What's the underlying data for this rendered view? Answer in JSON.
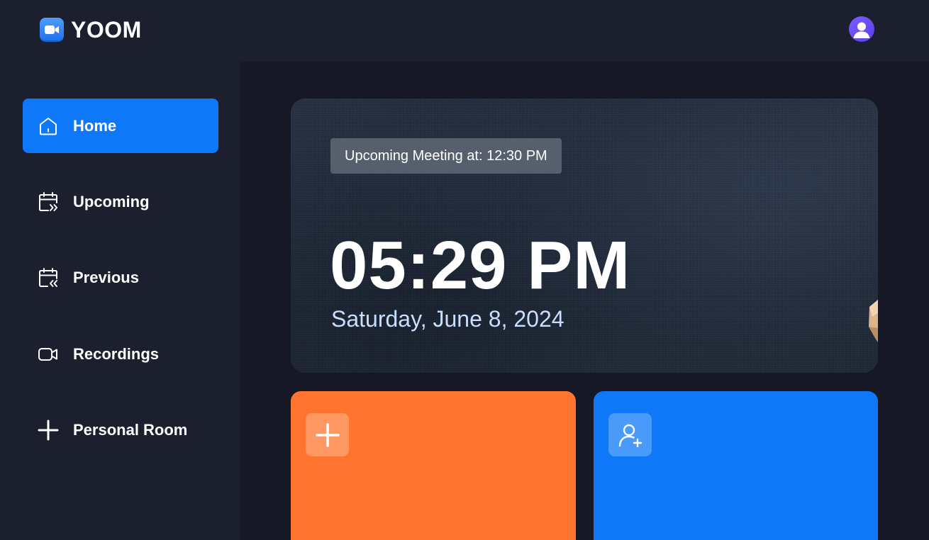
{
  "app": {
    "brand_name": "YOOM",
    "logo_icon": "video-camera-icon",
    "avatar_icon": "user-icon"
  },
  "sidebar": {
    "items": [
      {
        "label": "Home",
        "icon": "home-icon",
        "active": true
      },
      {
        "label": "Upcoming",
        "icon": "calendar-forward-icon",
        "active": false
      },
      {
        "label": "Previous",
        "icon": "calendar-back-icon",
        "active": false
      },
      {
        "label": "Recordings",
        "icon": "video-icon",
        "active": false
      },
      {
        "label": "Personal Room",
        "icon": "plus-icon",
        "active": false
      }
    ]
  },
  "hero": {
    "upcoming_text": "Upcoming Meeting at: 12:30 PM",
    "time": "05:29 PM",
    "date": "Saturday, June 8, 2024"
  },
  "cards": [
    {
      "icon": "plus-icon",
      "color": "#ff742e"
    },
    {
      "icon": "add-user-icon",
      "color": "#0e78f9"
    }
  ],
  "colors": {
    "accent_blue": "#0e78f9",
    "accent_orange": "#ff742e",
    "background": "#161925",
    "panel": "#1c1f2e",
    "date_text": "#c9ddff"
  }
}
